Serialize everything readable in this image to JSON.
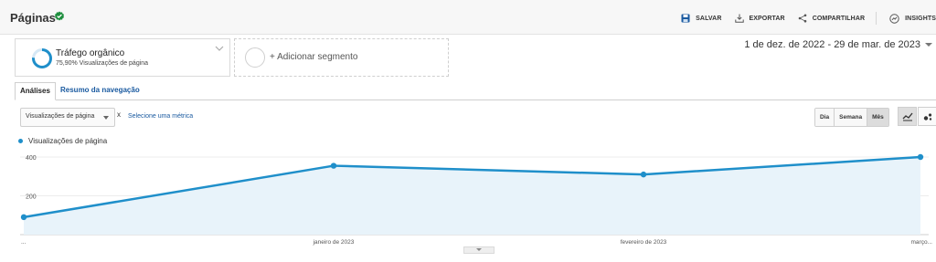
{
  "header": {
    "title": "Páginas",
    "actions": {
      "save": "SALVAR",
      "export": "EXPORTAR",
      "share": "COMPARTILHAR",
      "insights": "INSIGHTS"
    }
  },
  "segment": {
    "name": "Tráfego orgânico",
    "subtitle": "75,90% Visualizações de página",
    "percent": 75.9,
    "add_label": "+ Adicionar segmento"
  },
  "date_range": "1 de dez. de 2022 - 29 de mar. de 2023",
  "tabs": {
    "analysis": "Análises",
    "navigation": "Resumo da navegação"
  },
  "metric": {
    "selected": "Visualizações de página",
    "remove": "x",
    "select_metric": "Selecione uma métrica"
  },
  "period": {
    "day": "Dia",
    "week": "Semana",
    "month": "Mês"
  },
  "colors": {
    "accent": "#1f8fca",
    "area_fill": "#e8f3fa",
    "link": "#1a5aa0",
    "verified": "#1e8e3e"
  },
  "chart_data": {
    "type": "area",
    "series": [
      {
        "name": "Visualizações de página",
        "values": [
          90,
          355,
          310,
          400
        ]
      }
    ],
    "x": [
      "...",
      "janeiro de 2023",
      "fevereiro de 2023",
      "março..."
    ],
    "y_ticks": [
      "400",
      "200"
    ],
    "ylim": [
      0,
      420
    ],
    "grid": true
  }
}
